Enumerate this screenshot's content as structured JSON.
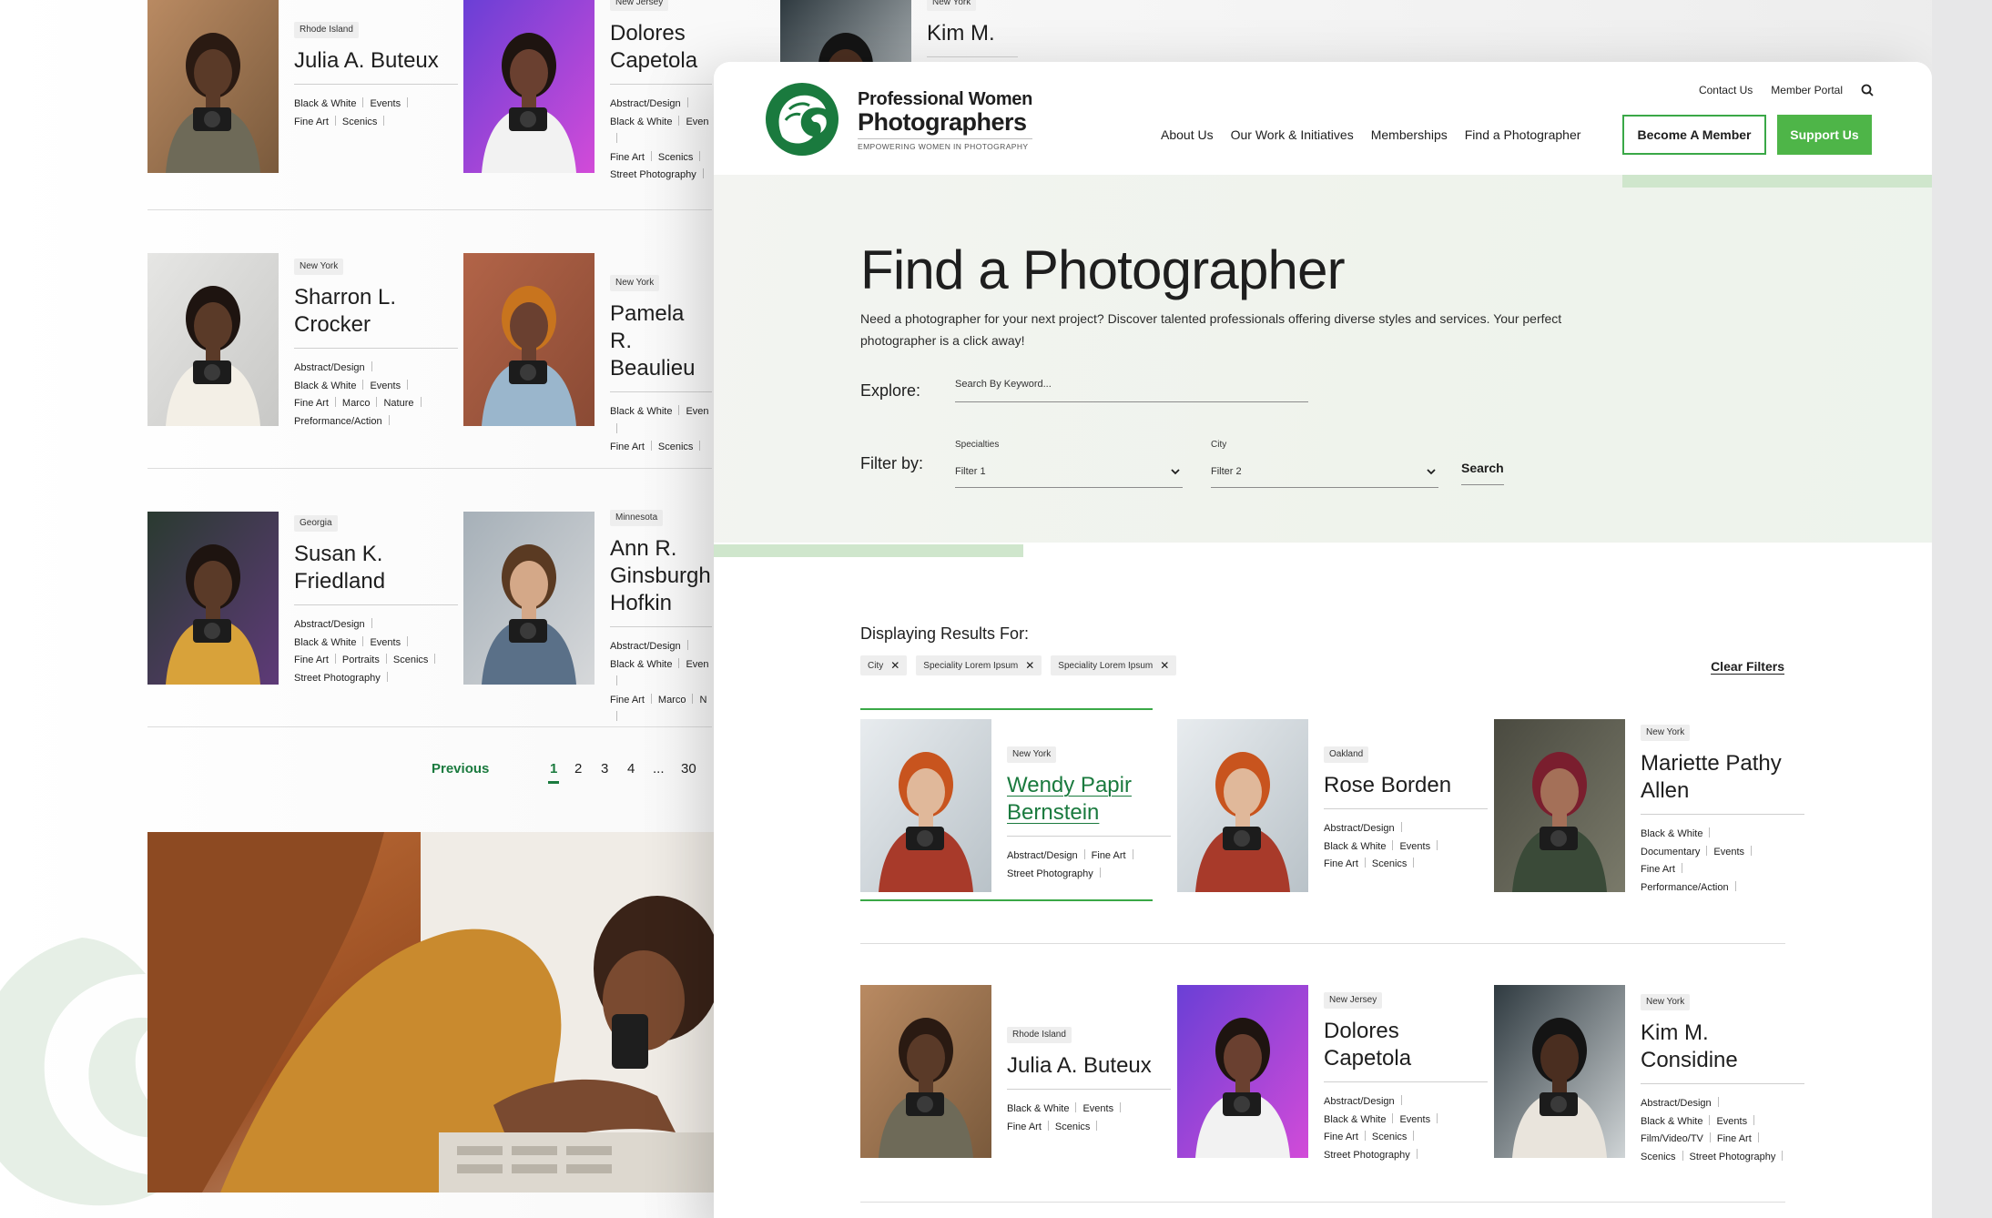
{
  "site": {
    "brand_line1": "Professional Women",
    "brand_line2": "Photographers",
    "tagline": "EMPOWERING WOMEN IN PHOTOGRAPHY",
    "util_links": [
      "Contact Us",
      "Member Portal"
    ],
    "nav": [
      "About Us",
      "Our Work & Initiatives",
      "Memberships",
      "Find a Photographer"
    ],
    "cta_member": "Become A Member",
    "cta_support": "Support Us",
    "brand_color": "#1a7a3e",
    "accent_color": "#4eb548"
  },
  "hero": {
    "title": "Find a Photographer",
    "description": "Need a photographer for your next project? Discover talented professionals offering diverse styles and services. Your perfect photographer is a click away!",
    "explore_label": "Explore:",
    "keyword_placeholder": "Search By Keyword...",
    "filter_label": "Filter by:",
    "specialties_label": "Specialties",
    "specialties_value": "Filter 1",
    "city_label": "City",
    "city_value": "Filter 2",
    "search_label": "Search"
  },
  "results": {
    "label": "Displaying Results For:",
    "chips": [
      "City",
      "Speciality Lorem Ipsum",
      "Speciality Lorem Ipsum"
    ],
    "clear_label": "Clear Filters",
    "cards": [
      {
        "tag": "New York",
        "name": "Wendy Papir Bernstein",
        "specs": [
          [
            "Abstract/Design",
            "Fine Art"
          ],
          [
            "Street Photography"
          ]
        ]
      },
      {
        "tag": "Oakland",
        "name": "Rose Borden",
        "specs": [
          [
            "Abstract/Design"
          ],
          [
            "Black & White",
            "Events"
          ],
          [
            "Fine Art",
            "Scenics"
          ]
        ]
      },
      {
        "tag": "New York",
        "name": "Mariette Pathy Allen",
        "specs": [
          [
            "Black & White"
          ],
          [
            "Documentary",
            "Events"
          ],
          [
            "Fine Art"
          ],
          [
            "Performance/Action"
          ]
        ]
      },
      {
        "tag": "Rhode Island",
        "name": "Julia A. Buteux",
        "specs": [
          [
            "Black & White",
            "Events"
          ],
          [
            "Fine Art",
            "Scenics"
          ]
        ]
      },
      {
        "tag": "New Jersey",
        "name": "Dolores Capetola",
        "specs": [
          [
            "Abstract/Design"
          ],
          [
            "Black & White",
            "Events"
          ],
          [
            "Fine Art",
            "Scenics"
          ],
          [
            "Street Photography"
          ]
        ]
      },
      {
        "tag": "New York",
        "name": "Kim M. Considine",
        "specs": [
          [
            "Abstract/Design"
          ],
          [
            "Black & White",
            "Events"
          ],
          [
            "Film/Video/TV",
            "Fine Art"
          ],
          [
            "Scenics",
            "Street Photography"
          ]
        ]
      }
    ]
  },
  "background_list": {
    "cards": [
      {
        "tag": "Rhode Island",
        "name": "Julia A. Buteux",
        "specs": [
          [
            "Black & White",
            "Events"
          ],
          [
            "Fine Art",
            "Scenics"
          ]
        ]
      },
      {
        "tag": "New Jersey",
        "name": "Dolores Capetola",
        "specs": [
          [
            "Abstract/Design"
          ],
          [
            "Black & White",
            "Even"
          ],
          [
            "Fine Art",
            "Scenics"
          ],
          [
            "Street Photography"
          ]
        ]
      },
      {
        "tag": "New York",
        "name": "Kim M.",
        "specs": []
      },
      {
        "tag": "New York",
        "name": "Sharron L. Crocker",
        "specs": [
          [
            "Abstract/Design"
          ],
          [
            "Black & White",
            "Events"
          ],
          [
            "Fine Art",
            "Marco",
            "Nature"
          ],
          [
            "Preformance/Action"
          ]
        ]
      },
      {
        "tag": "New York",
        "name": "Pamela R. Beaulieu",
        "specs": [
          [
            "Black & White",
            "Even"
          ],
          [
            "Fine Art",
            "Scenics"
          ]
        ]
      },
      {
        "tag": "Georgia",
        "name": "Susan K. Friedland",
        "specs": [
          [
            "Abstract/Design"
          ],
          [
            "Black & White",
            "Events"
          ],
          [
            "Fine Art",
            "Portraits",
            "Scenics"
          ],
          [
            "Street Photography"
          ]
        ]
      },
      {
        "tag": "Minnesota",
        "name": "Ann R. Ginsburgh Hofkin",
        "specs": [
          [
            "Abstract/Design"
          ],
          [
            "Black & White",
            "Even"
          ],
          [
            "Fine Art",
            "Marco",
            "N"
          ]
        ]
      }
    ],
    "pager": {
      "previous": "Previous",
      "pages": [
        "1",
        "2",
        "3",
        "4",
        "...",
        "30"
      ],
      "current": "1"
    }
  }
}
